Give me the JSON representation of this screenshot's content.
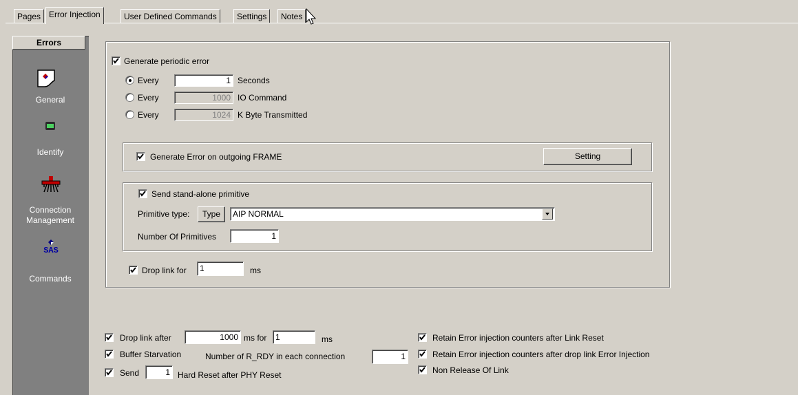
{
  "tabs": [
    "Pages",
    "Error Injection",
    "User Defined Commands",
    "Settings",
    "Notes"
  ],
  "sidebar": {
    "header": "Errors",
    "items": [
      {
        "label": "General",
        "icon": "general-icon"
      },
      {
        "label": "Identify",
        "icon": "identify-icon"
      },
      {
        "label": "Connection\nManagement",
        "icon": "connection-icon"
      },
      {
        "label": "Commands",
        "icon": "sas-commands-icon",
        "icon_text": "SAS"
      }
    ]
  },
  "periodic": {
    "checkbox_label": "Generate periodic error",
    "every_label": "Every",
    "rows": [
      {
        "value": "1",
        "unit": "Seconds",
        "selected": true
      },
      {
        "value": "1000",
        "unit": "IO Command",
        "selected": false
      },
      {
        "value": "1024",
        "unit": "K Byte Transmitted",
        "selected": false
      }
    ]
  },
  "frame": {
    "checkbox_label": "Generate Error on outgoing FRAME",
    "setting_button": "Setting"
  },
  "primitive": {
    "checkbox_label": "Send stand-alone primitive",
    "type_label": "Primitive type:",
    "type_button": "Type",
    "type_value": "AIP NORMAL",
    "count_label": "Number Of Primitives",
    "count_value": "1"
  },
  "drop_link": {
    "label": "Drop link for",
    "value": "1",
    "unit": "ms"
  },
  "bottom": {
    "drop_after_label": "Drop link after",
    "drop_after_value": "1000",
    "ms_for_label": "ms for",
    "ms_for_value": "1",
    "ms_label": "ms",
    "buffer_label": "Buffer Starvation",
    "rrdy_label": "Number of R_RDY in each connection",
    "rrdy_value": "1",
    "send_label": "Send",
    "send_value": "1",
    "hard_reset_label": "Hard Reset after PHY Reset",
    "retain_reset_label": "Retain Error injection counters after Link Reset",
    "retain_drop_label": "Retain Error injection counters after drop link Error Injection",
    "non_release_label": "Non Release Of Link"
  }
}
